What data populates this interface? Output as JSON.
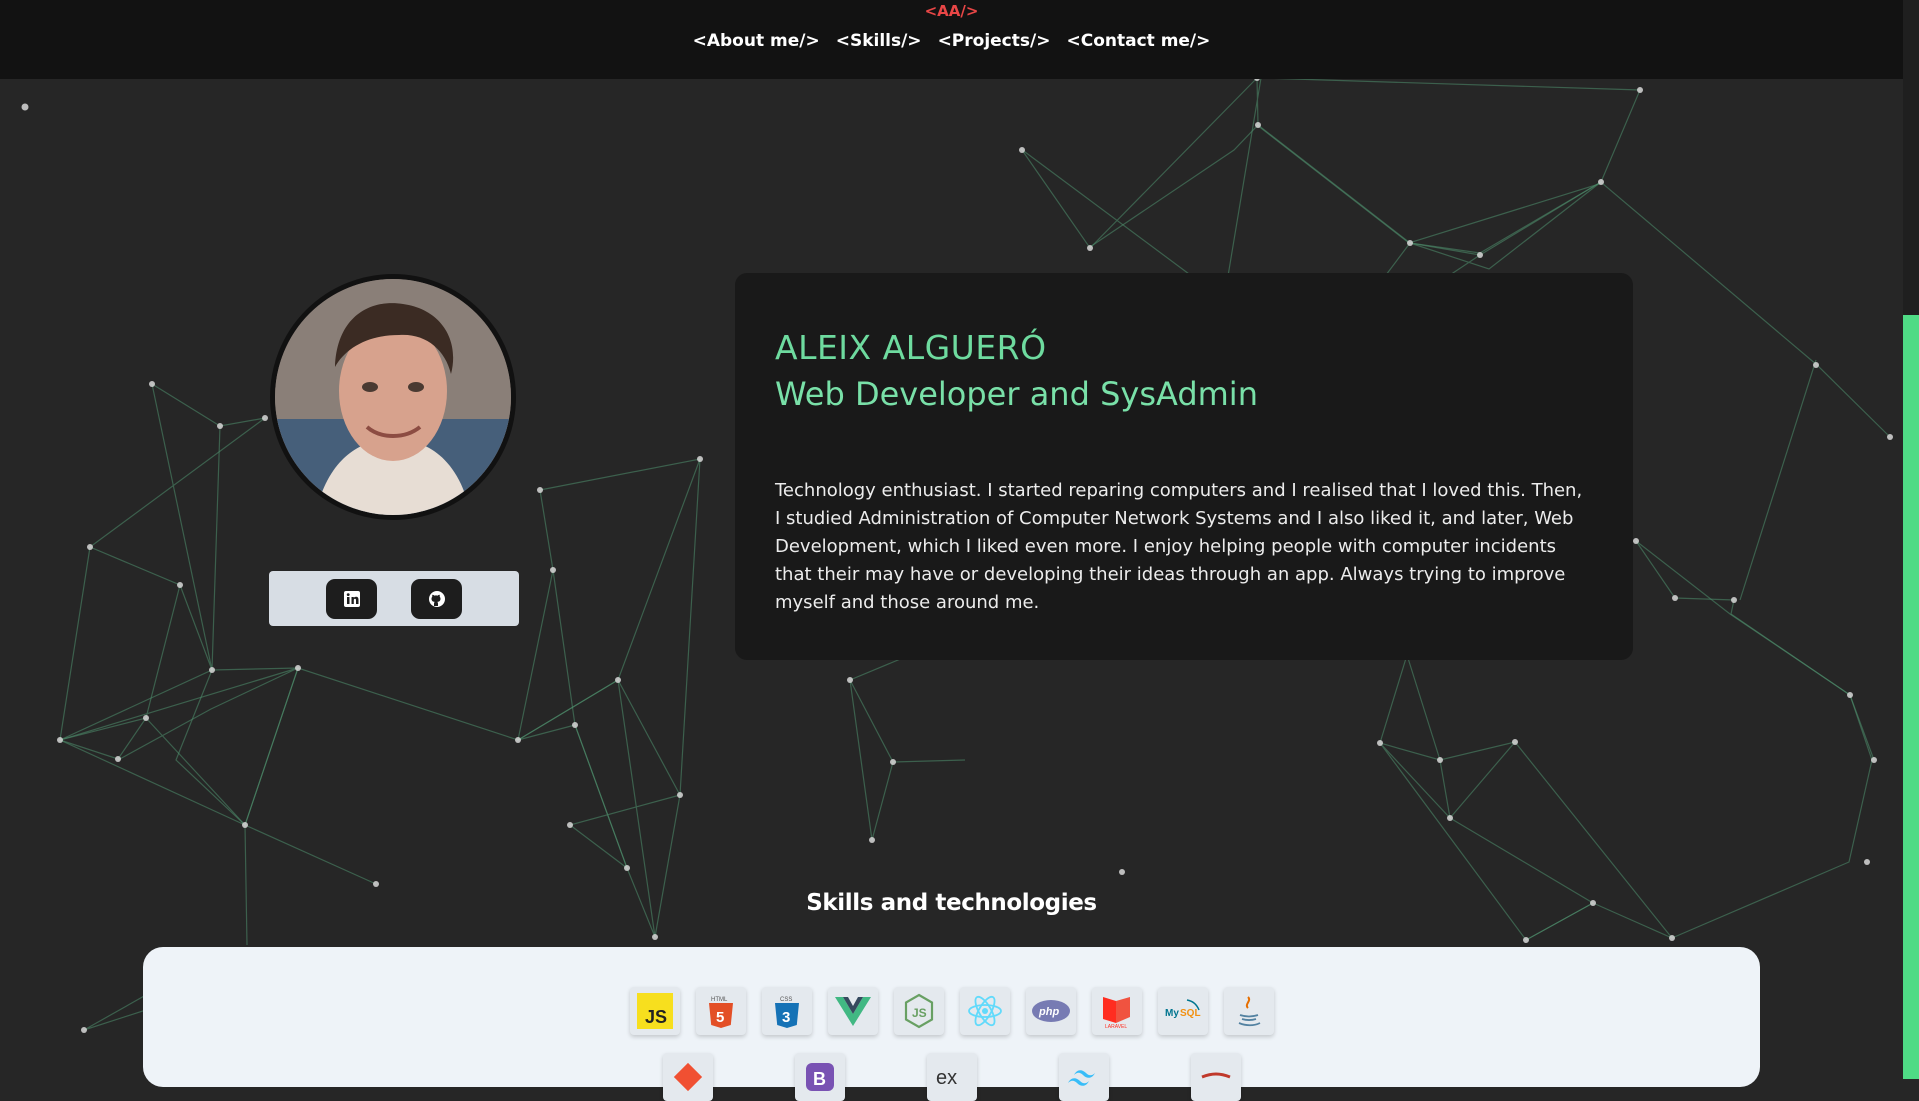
{
  "brand": "<AA/>",
  "nav": [
    "<About me/>",
    "<Skills/>",
    "<Projects/>",
    "<Contact me/>"
  ],
  "profile": {
    "name": "ALEIX ALGUERÓ",
    "role": "Web Developer and SysAdmin",
    "bio": "Technology enthusiast. I started reparing computers and I realised that I loved this. Then, I studied Administration of Computer Network Systems and I also liked it, and later, Web Development, which I liked even more. I enjoy helping people with computer incidents that their may have or developing their ideas through an app. Always trying to improve myself and those around me."
  },
  "social": [
    {
      "icon": "linkedin-icon"
    },
    {
      "icon": "github-icon"
    }
  ],
  "skills_title": "Skills and technologies",
  "skills_row1": [
    "javascript-icon",
    "html5-icon",
    "css3-icon",
    "vue-icon",
    "nodejs-icon",
    "react-icon",
    "php-icon",
    "laravel-icon",
    "mysql-icon",
    "java-icon"
  ],
  "skills_row2": [
    "git-icon",
    "bootstrap-icon",
    "express-icon",
    "tailwind-icon",
    "partial-icon"
  ],
  "colors": {
    "accent": "#6edb9f",
    "brand": "#e84646",
    "background": "#262626",
    "topbar": "#121212",
    "card": "#191919",
    "skills_panel": "#eef3f8"
  }
}
